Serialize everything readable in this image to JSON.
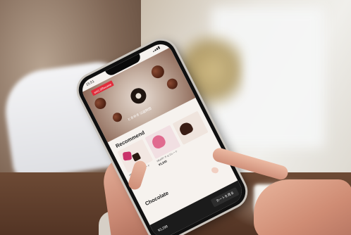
{
  "phone": {
    "status_time": "15:51",
    "hero_tag": "ent1.0Recome",
    "hero_caption": "ときめき 公益財団",
    "recommend_title": "Recommend",
    "cards": [
      {
        "name": "HEART チョコレート",
        "price": "¥3,298"
      },
      {
        "name": "HEART チョコレート",
        "price": "¥3,240"
      },
      {
        "name": "",
        "price": ""
      }
    ],
    "chocolate_title": "Chocolate",
    "bottom_price": "¥3,298",
    "cart_label": "カートを見る"
  },
  "colors": {
    "tag_red": "#e12c3b",
    "screen_bg": "#f6f2ee",
    "bottom_bar": "#1b1b1b"
  }
}
